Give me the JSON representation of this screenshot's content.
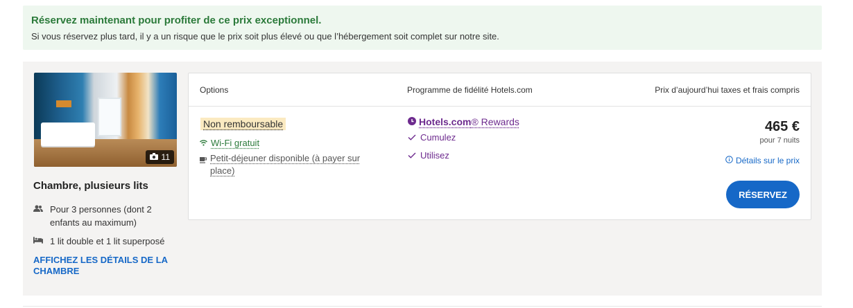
{
  "banner": {
    "title": "Réservez maintenant pour profiter de ce prix exceptionnel.",
    "text": "Si vous réservez plus tard, il y a un risque que le prix soit plus élevé ou que l’hébergement soit complet sur notre site."
  },
  "room": {
    "photo_count": "11",
    "title": "Chambre, plusieurs lits",
    "features": [
      {
        "icon": "people-icon",
        "text": "Pour 3 personnes (dont 2 enfants au maximum)"
      },
      {
        "icon": "bed-icon",
        "text": "1 lit double et 1 lit superposé"
      }
    ],
    "details_link": "AFFICHEZ LES DÉTAILS DE LA CHAMBRE"
  },
  "table": {
    "headers": {
      "options": "Options",
      "program": "Programme de fidélité Hotels.com",
      "price": "Prix d’aujourd’hui taxes et frais compris"
    },
    "options": {
      "badge": "Non remboursable",
      "wifi": "Wi-Fi gratuit",
      "breakfast": "Petit-déjeuner disponible (à payer sur place)"
    },
    "loyalty": {
      "brand": "Hotels.com",
      "brand_suffix": "® Rewards",
      "items": [
        "Cumulez",
        "Utilisez"
      ]
    },
    "price": {
      "amount": "465 €",
      "nights": "pour 7 nuits",
      "details": "Détails sur le prix",
      "button": "RÉSERVEZ"
    }
  },
  "colors": {
    "accent": "#1668c7",
    "success": "#2b7a3a",
    "loyalty": "#6d2a8e",
    "badge_bg": "#fbeac1",
    "banner_bg": "#eef7ef",
    "card_bg": "#f4f3f2"
  }
}
